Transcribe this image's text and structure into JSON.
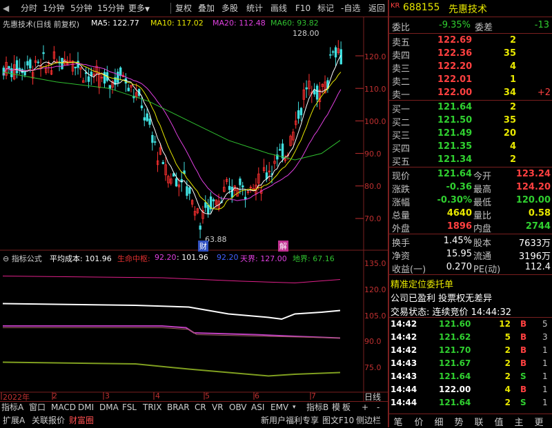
{
  "toolbar": {
    "items": [
      "分时",
      "1分钟",
      "5分钟",
      "15分钟",
      "更多",
      "复权",
      "叠加",
      "多股",
      "统计",
      "画线",
      "F10",
      "标记",
      "-自选",
      "返回"
    ]
  },
  "chart": {
    "title": "先惠技术(日线 前复权)",
    "ma5": "MA5: 122.77",
    "ma10": "MA10: 117.02",
    "ma20": "MA20: 112.48",
    "ma60": "MA60: 93.82",
    "high_mark": "128.00",
    "low_mark": "63.88",
    "tag_left": "财",
    "tag_right": "解",
    "price_axis": [
      "120.0",
      "110.0",
      "100.0",
      "90.0",
      "80.0",
      "70.0"
    ],
    "x_axis": [
      "2022年",
      "2",
      "3",
      "4",
      "5",
      "6",
      "7"
    ],
    "period": "日线",
    "colors": {
      "ma5": "#ffffff",
      "ma10": "#e8e800",
      "ma20": "#e040e0",
      "ma60": "#30c030",
      "up": "#ff3030",
      "down": "#40e0e0"
    }
  },
  "indicator": {
    "title": "指标公式",
    "avg_cost": "平均成本: 101.96",
    "life_center_label": "生命中枢: ",
    "life_center_value": "92.20",
    "v2": ": 101.96",
    "v3": "92.20",
    "sky": "天界: 127.00",
    "earth": "地界: 67.16",
    "axis": [
      "135.0",
      "120.0",
      "105.0",
      "90.0",
      "75.0"
    ]
  },
  "bottom_tabs": [
    "指标A",
    "窗口",
    "MACD",
    "DMI",
    "DMA",
    "FSL",
    "TRIX",
    "BRAR",
    "CR",
    "VR",
    "OBV",
    "ASI",
    "EMV",
    "▾",
    "指标B",
    "模",
    "板",
    "+",
    "-"
  ],
  "bottom_bar": {
    "left": [
      "扩展A",
      "关联报价",
      "财富圈"
    ],
    "right": [
      "新用户福利专享",
      "图文F10",
      "侧边栏"
    ]
  },
  "quote": {
    "badge": "KR",
    "code": "688155",
    "name": "先惠技术",
    "weibi_label": "委比",
    "weibi": "-9.35%",
    "weicha_label": "委差",
    "weicha": "-13",
    "asks": [
      {
        "label": "卖五",
        "price": "122.69",
        "vol": "2",
        "chg": ""
      },
      {
        "label": "卖四",
        "price": "122.36",
        "vol": "35",
        "chg": ""
      },
      {
        "label": "卖三",
        "price": "122.20",
        "vol": "4",
        "chg": ""
      },
      {
        "label": "卖二",
        "price": "122.01",
        "vol": "1",
        "chg": ""
      },
      {
        "label": "卖一",
        "price": "122.00",
        "vol": "34",
        "chg": "+2"
      }
    ],
    "bids": [
      {
        "label": "买一",
        "price": "121.64",
        "vol": "2"
      },
      {
        "label": "买二",
        "price": "121.50",
        "vol": "35"
      },
      {
        "label": "买三",
        "price": "121.49",
        "vol": "20"
      },
      {
        "label": "买四",
        "price": "121.35",
        "vol": "4"
      },
      {
        "label": "买五",
        "price": "121.34",
        "vol": "2"
      }
    ],
    "stats": [
      {
        "l1": "现价",
        "v1": "121.64",
        "l2": "今开",
        "v2": "123.24"
      },
      {
        "l1": "涨跌",
        "v1": "-0.36",
        "l2": "最高",
        "v2": "124.20"
      },
      {
        "l1": "涨幅",
        "v1": "-0.30%",
        "l2": "最低",
        "v2": "120.00"
      },
      {
        "l1": "总量",
        "v1": "4640",
        "l2": "量比",
        "v2": "0.58"
      },
      {
        "l1": "外盘",
        "v1": "1896",
        "l2": "内盘",
        "v2": "2744"
      }
    ],
    "stats2": [
      {
        "l1": "换手",
        "v1": "1.45%",
        "l2": "股本",
        "v2": "7633万"
      },
      {
        "l1": "净资",
        "v1": "15.95",
        "l2": "流通",
        "v2": "3196万"
      },
      {
        "l1": "收益(一)",
        "v1": "0.270",
        "l2": "PE(动)",
        "v2": "112.4"
      }
    ],
    "notice1": "精准定位委托单",
    "notice2": "公司已盈利 投票权无差异",
    "trade_state": "交易状态: 连续竞价 14:44:32",
    "ticks": [
      {
        "t": "14:42",
        "p": "121.60",
        "v": "12",
        "s": "B",
        "n": "5"
      },
      {
        "t": "14:42",
        "p": "121.62",
        "v": "5",
        "s": "B",
        "n": "3"
      },
      {
        "t": "14:42",
        "p": "121.70",
        "v": "2",
        "s": "B",
        "n": "1"
      },
      {
        "t": "14:43",
        "p": "121.67",
        "v": "2",
        "s": "B",
        "n": "1"
      },
      {
        "t": "14:43",
        "p": "121.64",
        "v": "2",
        "s": "S",
        "n": "1"
      },
      {
        "t": "14:44",
        "p": "122.00",
        "v": "4",
        "s": "B",
        "n": "1"
      },
      {
        "t": "14:44",
        "p": "121.64",
        "v": "2",
        "s": "S",
        "n": "1"
      }
    ],
    "tabs": [
      "笔",
      "价",
      "细",
      "势",
      "联",
      "值",
      "主",
      "更"
    ]
  }
}
